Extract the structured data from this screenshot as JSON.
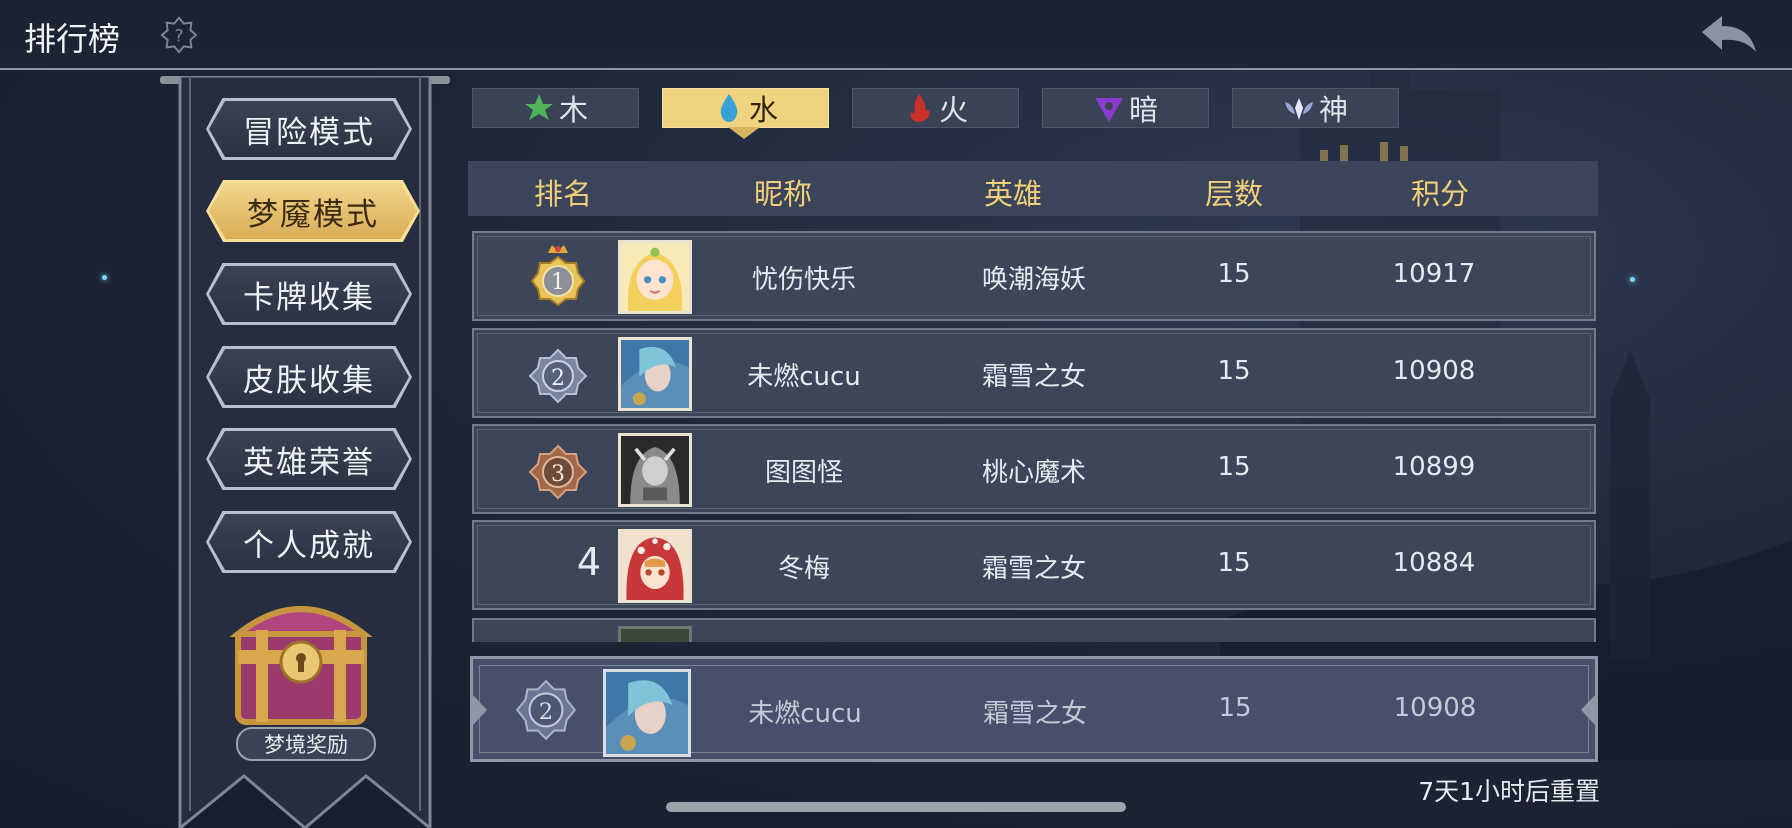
{
  "header": {
    "title": "排行榜",
    "help_icon": "help-gear-icon",
    "back_icon": "back-arrow-icon"
  },
  "sidebar": {
    "items": [
      {
        "label": "冒险模式",
        "active": false
      },
      {
        "label": "梦魇模式",
        "active": true
      },
      {
        "label": "卡牌收集",
        "active": false
      },
      {
        "label": "皮肤收集",
        "active": false
      },
      {
        "label": "英雄荣誉",
        "active": false
      },
      {
        "label": "个人成就",
        "active": false
      }
    ],
    "reward_label": "梦境奖励",
    "reward_icon": "treasure-chest-icon"
  },
  "tabs": [
    {
      "label": "木",
      "icon": "leaf-icon",
      "color": "#4fb35a",
      "active": false
    },
    {
      "label": "水",
      "icon": "water-drop-icon",
      "color": "#3aa0d8",
      "active": true
    },
    {
      "label": "火",
      "icon": "fire-icon",
      "color": "#c8302a",
      "active": false
    },
    {
      "label": "暗",
      "icon": "dark-triangle-icon",
      "color": "#8a3ad0",
      "active": false
    },
    {
      "label": "神",
      "icon": "divine-wings-icon",
      "color": "#b9c3e6",
      "active": false
    }
  ],
  "table": {
    "headers": {
      "rank": "排名",
      "nickname": "昵称",
      "hero": "英雄",
      "floors": "层数",
      "score": "积分"
    },
    "rows": [
      {
        "rank": "1",
        "rank_style": "gold",
        "avatar": "avatar-blonde-elf",
        "nickname": "忧伤快乐",
        "hero": "唤潮海妖",
        "floors": "15",
        "score": "10917"
      },
      {
        "rank": "2",
        "rank_style": "silver",
        "avatar": "avatar-blue-hair-elf",
        "nickname": "未燃cucu",
        "hero": "霜雪之女",
        "floors": "15",
        "score": "10908"
      },
      {
        "rank": "3",
        "rank_style": "bronze",
        "avatar": "avatar-grey-knight",
        "nickname": "图图怪",
        "hero": "桃心魔术",
        "floors": "15",
        "score": "10899"
      },
      {
        "rank": "4",
        "rank_style": "plain",
        "avatar": "avatar-red-hood",
        "nickname": "冬梅",
        "hero": "霜雪之女",
        "floors": "15",
        "score": "10884"
      }
    ],
    "self": {
      "rank": "2",
      "avatar": "avatar-blue-hair-elf",
      "nickname": "未燃cucu",
      "hero": "霜雪之女",
      "floors": "15",
      "score": "10908"
    }
  },
  "reset_text": "7天1小时后重置"
}
